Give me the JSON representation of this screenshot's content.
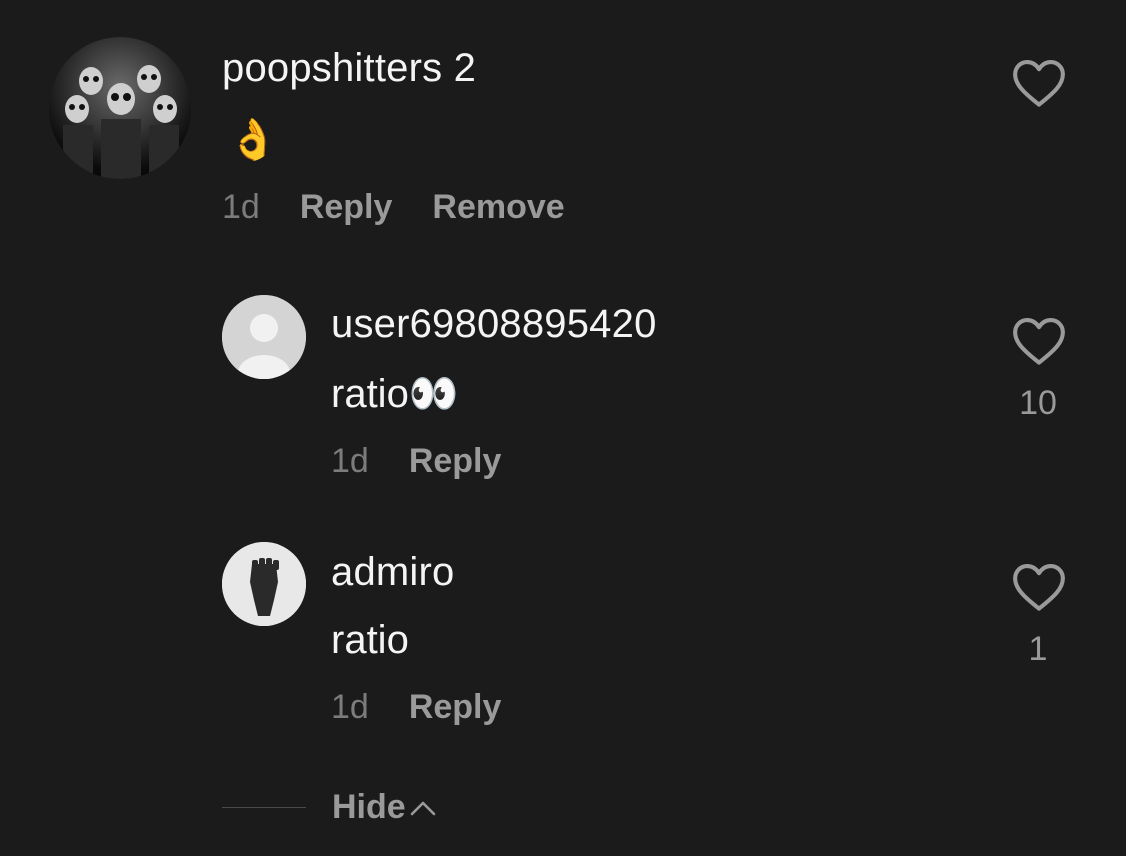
{
  "comments": [
    {
      "username": "poopshitters 2",
      "text": "👌",
      "time": "1d",
      "reply_label": "Reply",
      "remove_label": "Remove",
      "like_count": ""
    },
    {
      "username": "user69808895420",
      "text": "ratio👀",
      "time": "1d",
      "reply_label": "Reply",
      "like_count": "10"
    },
    {
      "username": "admiro",
      "text": "ratio",
      "time": "1d",
      "reply_label": "Reply",
      "like_count": "1"
    }
  ],
  "hide_label": "Hide",
  "colors": {
    "background": "#1b1b1b",
    "text_primary": "#f4f4f4",
    "text_secondary": "#9a9a9a",
    "text_muted": "#7c7c7c"
  },
  "icons": {
    "like": "heart-outline-icon",
    "collapse": "chevron-up-icon"
  }
}
